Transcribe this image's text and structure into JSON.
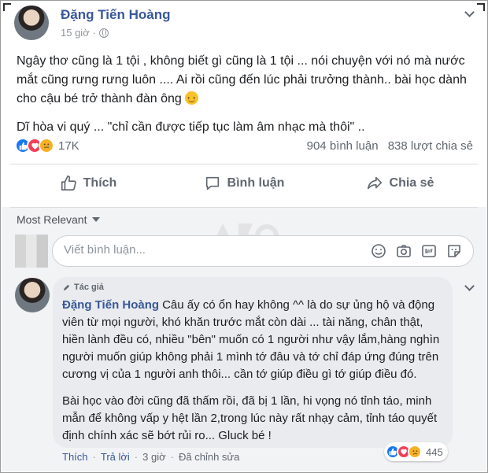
{
  "post": {
    "author": "Đặng Tiến Hoàng",
    "time": "15 giờ",
    "privacy_icon": "globe-icon",
    "paragraphs": [
      "Ngây thơ cũng là 1 tội , không biết gì cũng là 1 tội ... nói chuyện với nó mà nước mắt cũng rưng rưng luôn .... Ai rồi cũng đến lúc phải trưởng thành.. bài học dành cho cậu bé trở thành đàn ông",
      "Dĩ hòa vi quý ... \"chỉ cần được tiếp tục làm âm nhạc mà thôi\" .."
    ],
    "reactions": [
      "like",
      "love",
      "sad"
    ],
    "reaction_count": "17K",
    "comments_count": "904 bình luận",
    "shares_count": "838 lượt chia sẻ"
  },
  "actions": {
    "like": "Thích",
    "comment": "Bình luận",
    "share": "Chia sẻ"
  },
  "comments_section": {
    "sort_label": "Most Relevant",
    "input_placeholder": "Viết bình luận...",
    "input_icons": [
      "smiley-icon",
      "camera-icon",
      "gif-icon",
      "sticker-icon"
    ]
  },
  "comment": {
    "badge": "Tác giả",
    "author": "Đặng Tiến Hoàng",
    "text_1": "Câu ấy có ổn hay không ^^ là do sự ủng hộ và động viên từ mọi người, khó khăn trước mắt còn dài ... tài năng, chân thật, hiền lành đều có, nhiều \"bên\" muốn có 1 người như vậy lắm,hàng nghìn người muốn giúp không phải 1 mình tớ đâu và tớ chỉ đáp ứng đúng trên cương vị của 1 người anh thôi... cần tớ giúp điều gì tớ giúp điều đó.",
    "text_2": "Bài học vào đời cũng đã thấm rồi, đã bị 1 lần, hi vọng nó tỉnh táo, minh mẫn để không vấp y hệt lần 2,trong lúc này rất nhạy cảm, tỉnh táo quyết định chính xác sẽ bớt rủi ro... Gluck bé !",
    "like": "Thích",
    "reply": "Trả lời",
    "time": "3 giờ",
    "edited": "Đã chỉnh sửa",
    "reaction_count": "445"
  },
  "colors": {
    "link": "#385898",
    "like_blue": "#1877f2",
    "love_red": "#f33e58",
    "sad_yellow": "#f7b125",
    "secondary_text": "#606770"
  }
}
